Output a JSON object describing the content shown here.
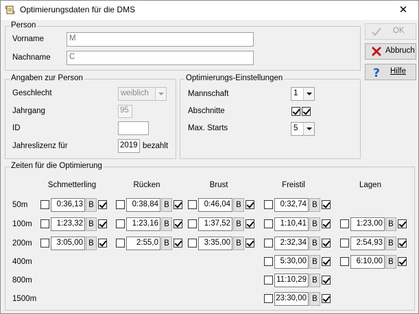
{
  "window": {
    "title": "Optimierungsdaten für die DMS"
  },
  "buttons": {
    "ok": "OK",
    "abbruch": "Abbruch",
    "hilfe": "Hilfe"
  },
  "person": {
    "group_label": "Person",
    "vorname_label": "Vorname",
    "vorname_value": "M",
    "nachname_label": "Nachname",
    "nachname_value": "C"
  },
  "angaben": {
    "group_label": "Angaben zur Person",
    "geschlecht_label": "Geschlecht",
    "geschlecht_value": "weiblich",
    "jahrgang_label": "Jahrgang",
    "jahrgang_value": "95",
    "id_label": "ID",
    "id_value": "",
    "lizenz_label": "Jahreslizenz für",
    "lizenz_value": "2019",
    "bezahlt_label": "bezahlt"
  },
  "optimierung": {
    "group_label": "Optimierungs-Einstellungen",
    "mannschaft_label": "Mannschaft",
    "mannschaft_value": "1",
    "abschnitte_label": "Abschnitte",
    "abschnitte_cb1": true,
    "abschnitte_cb2": true,
    "maxstarts_label": "Max. Starts",
    "maxstarts_value": "5"
  },
  "zeiten": {
    "group_label": "Zeiten für die Optimierung",
    "b_label": "B",
    "strokes": [
      "Schmetterling",
      "Rücken",
      "Brust",
      "Freistil",
      "Lagen"
    ],
    "distances": [
      "50m",
      "100m",
      "200m",
      "400m",
      "800m",
      "1500m"
    ],
    "rows": [
      {
        "cells": [
          {
            "time": "0:36,13",
            "checked": true
          },
          {
            "time": "0:38,84",
            "checked": true
          },
          {
            "time": "0:46,04",
            "checked": true
          },
          {
            "time": "0:32,74",
            "checked": true
          },
          null
        ]
      },
      {
        "cells": [
          {
            "time": "1:23,32",
            "checked": true
          },
          {
            "time": "1:23,16",
            "checked": true
          },
          {
            "time": "1:37,52",
            "checked": true
          },
          {
            "time": "1:10,41",
            "checked": true
          },
          {
            "time": "1:23,00",
            "checked": true
          }
        ]
      },
      {
        "cells": [
          {
            "time": "3:05,00",
            "checked": true
          },
          {
            "time": "2:55,0",
            "checked": true
          },
          {
            "time": "3:35,00",
            "checked": true
          },
          {
            "time": "2:32,34",
            "checked": true
          },
          {
            "time": "2:54,93",
            "checked": true
          }
        ]
      },
      {
        "cells": [
          null,
          null,
          null,
          {
            "time": "5:30,00",
            "checked": true
          },
          {
            "time": "6:10,00",
            "checked": true
          }
        ]
      },
      {
        "cells": [
          null,
          null,
          null,
          {
            "time": "11:10,29",
            "checked": true
          },
          null
        ]
      },
      {
        "cells": [
          null,
          null,
          null,
          {
            "time": "23:30,00",
            "checked": true
          },
          null
        ]
      }
    ]
  }
}
